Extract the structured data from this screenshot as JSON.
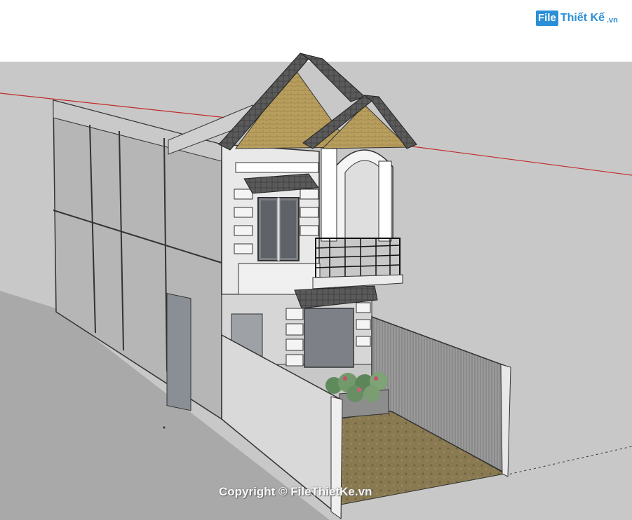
{
  "watermark_logo": {
    "box_text": "File",
    "text": "Thiết Kế",
    "ext": ".vn"
  },
  "copyright": "Copyright © FileThietKe.vn",
  "colors": {
    "sky": "#ffffff",
    "ground": "#c8c8c8",
    "shadow": "#a9a9a9",
    "wall": "#b4b4b4",
    "roof": "#4d4d4d",
    "red_axis": "#d02020",
    "floor": "#8c7d55"
  }
}
